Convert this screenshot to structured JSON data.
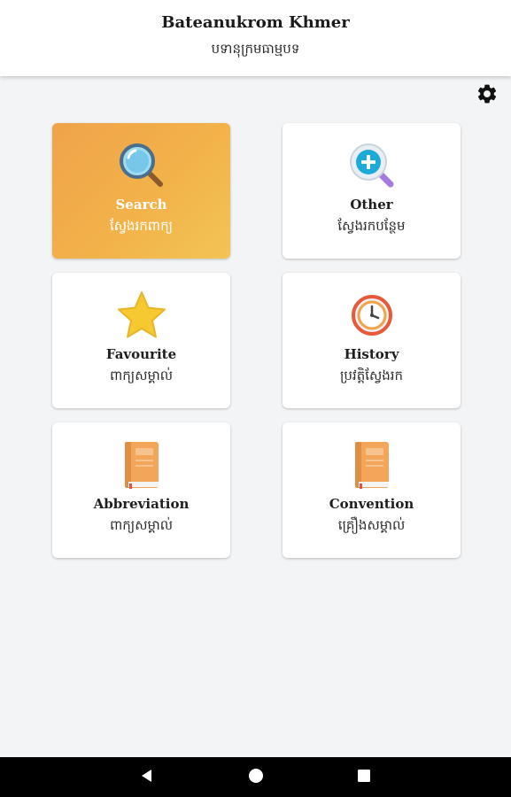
{
  "header": {
    "title": "Bateanukrom Khmer",
    "subtitle": "បទានុក្រមធាម្មបទ"
  },
  "settings": {
    "icon": "gear-icon"
  },
  "colors": {
    "accent_gradient_start": "#f0a34a",
    "accent_gradient_end": "#f3c455",
    "background": "#f3f4f6",
    "nav_bar": "#000000"
  },
  "menu": [
    {
      "label": "Search",
      "sub": "ស្វែងរកពាក្យ",
      "icon": "magnifier-icon",
      "active": true
    },
    {
      "label": "Other",
      "sub": "ស្វែងរកបន្ថែម",
      "icon": "search-plus-icon",
      "active": false
    },
    {
      "label": "Favourite",
      "sub": "ពាក្យសម្គាល់",
      "icon": "star-icon",
      "active": false
    },
    {
      "label": "History",
      "sub": "ប្រវត្តិស្វែងរក",
      "icon": "clock-icon",
      "active": false
    },
    {
      "label": "Abbreviation",
      "sub": "ពាក្យសម្គាល់",
      "icon": "book-icon",
      "active": false
    },
    {
      "label": "Convention",
      "sub": "គ្រឿងសម្គាល់",
      "icon": "book-icon",
      "active": false
    }
  ],
  "navigation": {
    "back_icon": "back-triangle-icon",
    "home_icon": "home-circle-icon",
    "recents_icon": "recents-square-icon"
  }
}
